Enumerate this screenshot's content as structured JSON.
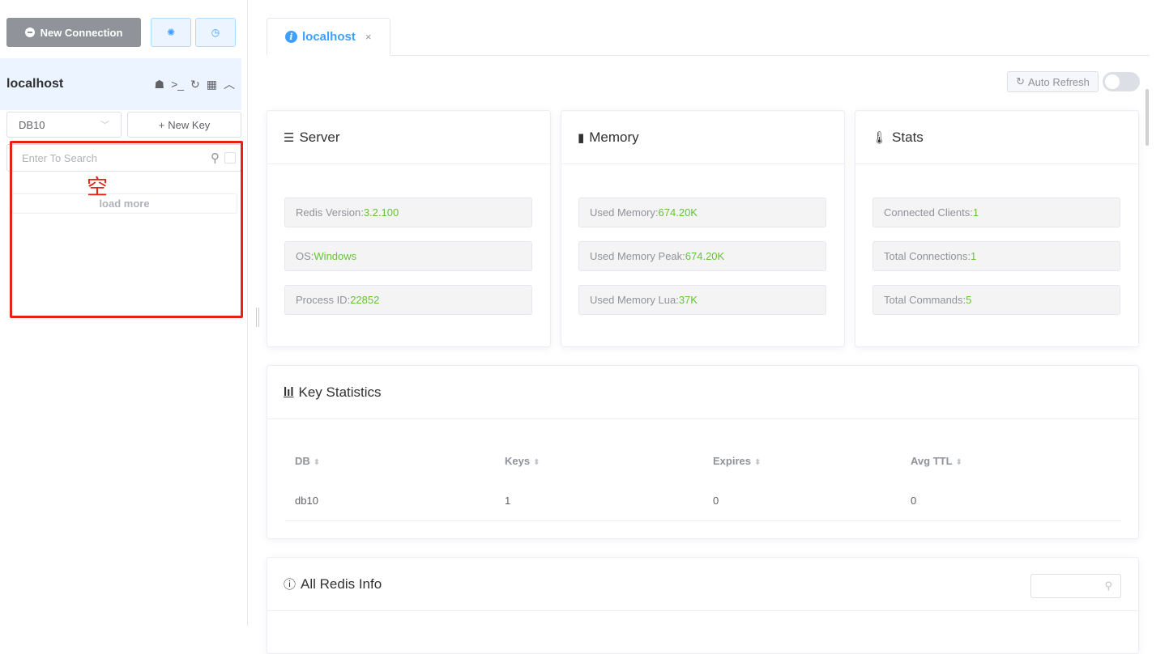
{
  "sidebar": {
    "new_connection_label": "New Connection",
    "connection_name": "localhost",
    "db_selected": "DB10",
    "new_key_label": "New Key",
    "search_placeholder": "Enter To Search",
    "load_more_label": "load more",
    "empty_annotation": "空"
  },
  "tab": {
    "label": "localhost",
    "close": "×"
  },
  "toolbar": {
    "auto_refresh_label": "Auto Refresh",
    "auto_refresh_on": false
  },
  "server": {
    "title": "Server",
    "items": [
      {
        "label": "Redis Version: ",
        "value": "3.2.100"
      },
      {
        "label": "OS: ",
        "value": "Windows"
      },
      {
        "label": "Process ID: ",
        "value": "22852"
      }
    ]
  },
  "memory": {
    "title": "Memory",
    "items": [
      {
        "label": "Used Memory: ",
        "value": "674.20K"
      },
      {
        "label": "Used Memory Peak: ",
        "value": "674.20K"
      },
      {
        "label": "Used Memory Lua: ",
        "value": "37K"
      }
    ]
  },
  "stats": {
    "title": "Stats",
    "items": [
      {
        "label": "Connected Clients: ",
        "value": "1"
      },
      {
        "label": "Total Connections: ",
        "value": "1"
      },
      {
        "label": "Total Commands: ",
        "value": "5"
      }
    ]
  },
  "key_statistics": {
    "title": "Key Statistics",
    "columns": [
      "DB",
      "Keys",
      "Expires",
      "Avg TTL"
    ],
    "rows": [
      [
        "db10",
        "1",
        "0",
        "0"
      ]
    ]
  },
  "all_info": {
    "title": "All Redis Info"
  },
  "colors": {
    "accent": "#409eff",
    "value_green": "#67c23a",
    "annotation_red": "#e62117"
  }
}
